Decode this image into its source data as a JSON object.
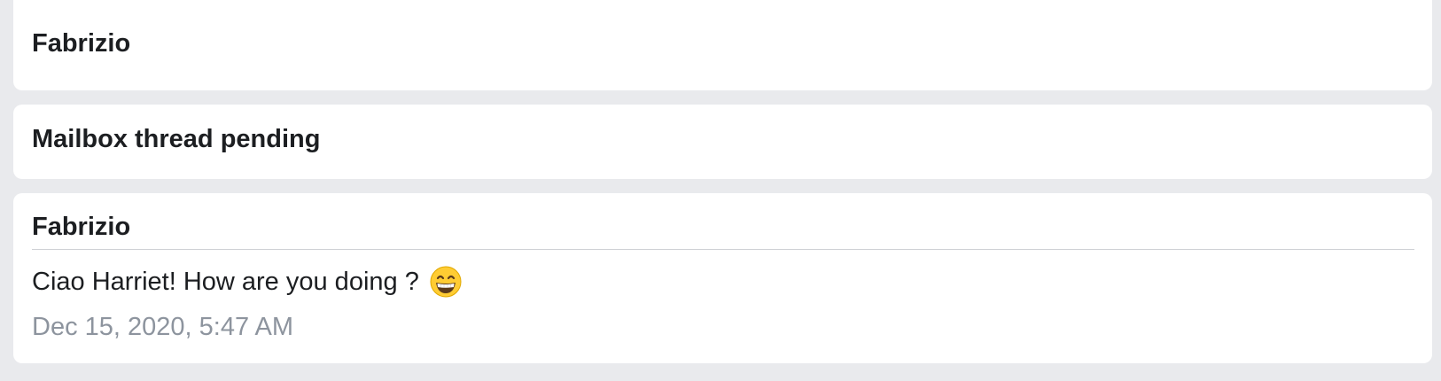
{
  "cards": [
    {
      "heading": "Fabrizio"
    },
    {
      "heading": "Mailbox thread pending"
    },
    {
      "heading": "Fabrizio",
      "message": "Ciao Harriet! How are you doing ?",
      "emoji_icon": "grinning-face-with-smiling-eyes-icon",
      "timestamp": "Dec 15, 2020, 5:47 AM"
    }
  ],
  "colors": {
    "background": "#e9eaed",
    "card": "#ffffff",
    "text": "#1c1e21",
    "timestamp": "#8d949e",
    "divider": "#cfd1d5"
  }
}
